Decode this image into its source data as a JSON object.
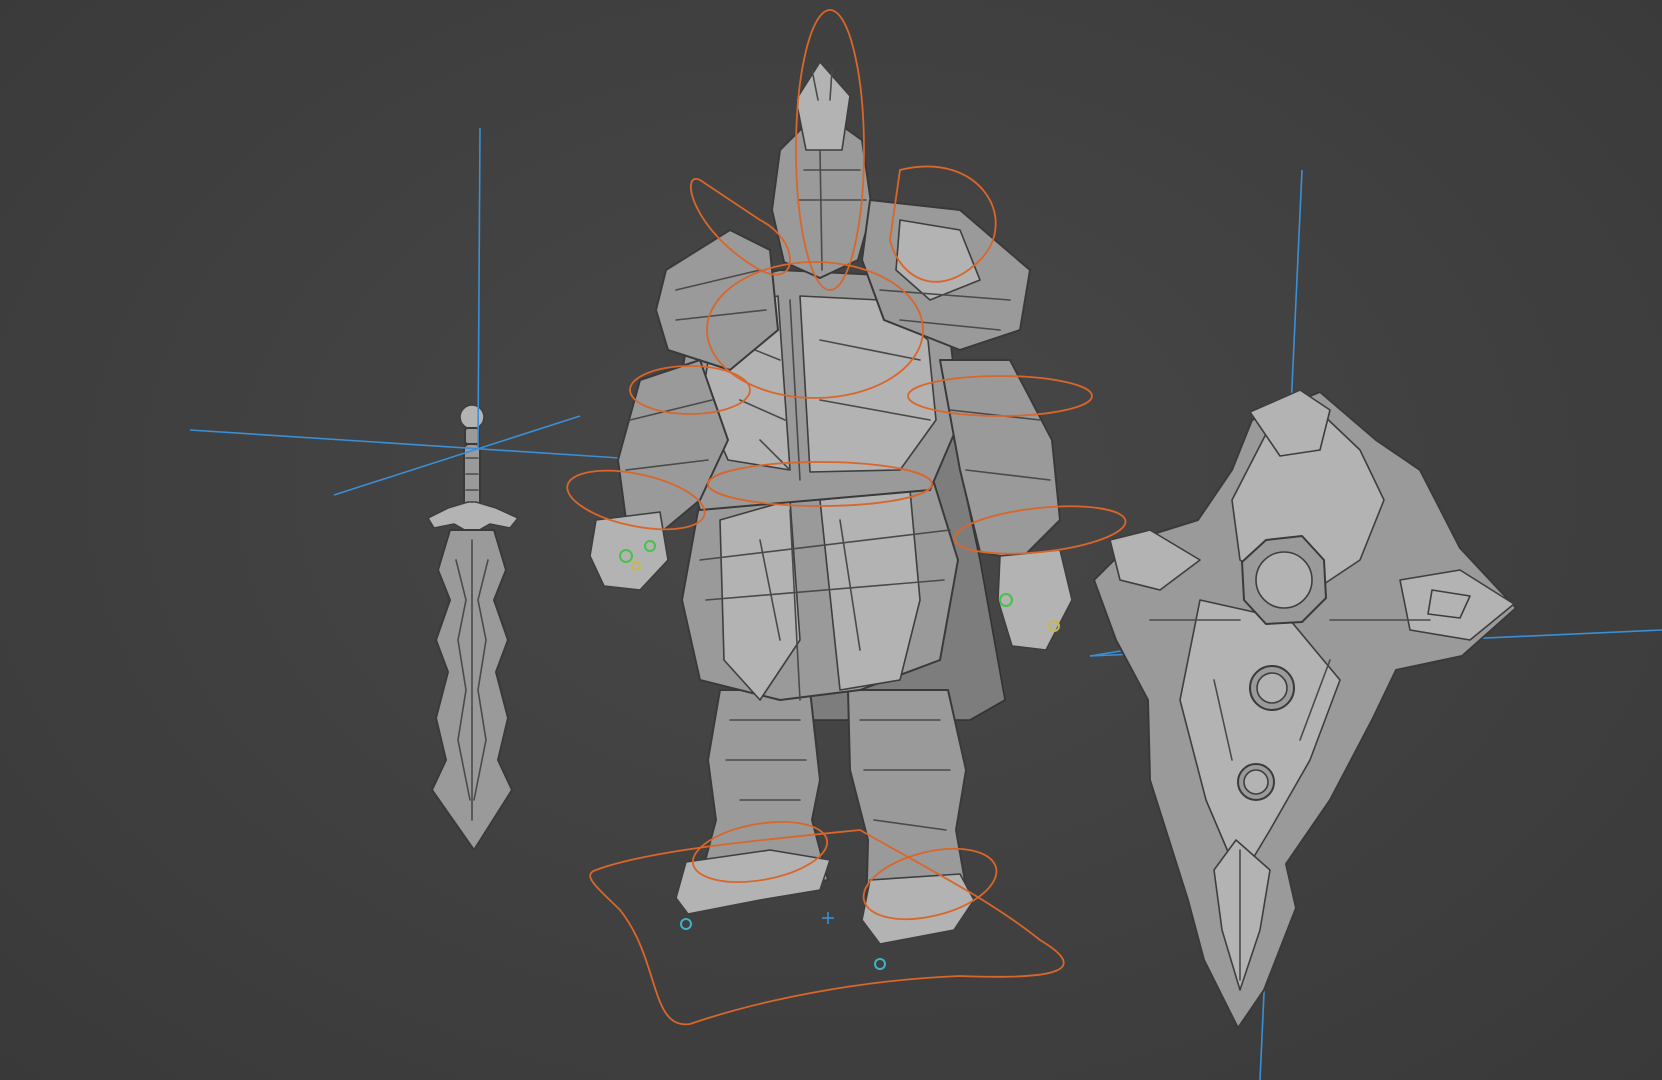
{
  "viewport": {
    "background_color": "#3f3f3f",
    "mesh_color": "#9a9a9a",
    "controller_color": "#d9662a",
    "pivot_axis_color": "#3a8fd6",
    "ik_handle_colors": [
      "#46c24a",
      "#c8b84a",
      "#3fb3c2"
    ]
  },
  "scene": {
    "objects": [
      "knight-character",
      "sword-prop",
      "shield-prop"
    ],
    "icons": [
      "pivot-axis-icon",
      "rig-controller-icon",
      "ik-handle-icon",
      "world-origin-icon"
    ]
  }
}
